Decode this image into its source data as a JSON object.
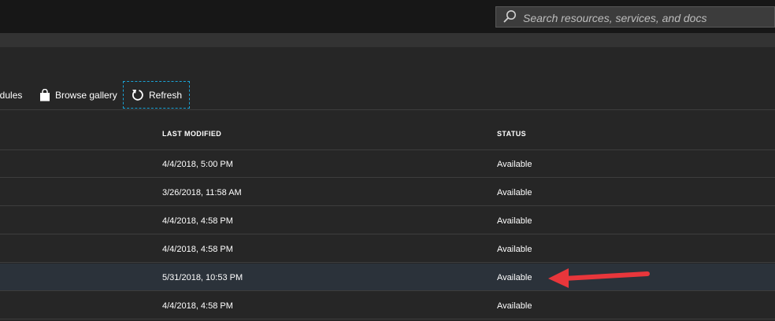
{
  "search": {
    "placeholder": "Search resources, services, and docs",
    "icon": "search-icon"
  },
  "toolbar": {
    "partial_label": "odules",
    "browse_label": "Browse gallery",
    "browse_icon": "shopping-bag-icon",
    "refresh_label": "Refresh",
    "refresh_icon": "refresh-icon"
  },
  "table": {
    "columns": [
      "LAST MODIFIED",
      "STATUS"
    ],
    "rows": [
      {
        "last_modified": "4/4/2018, 5:00 PM",
        "status": "Available"
      },
      {
        "last_modified": "3/26/2018, 11:58 AM",
        "status": "Available"
      },
      {
        "last_modified": "4/4/2018, 4:58 PM",
        "status": "Available"
      },
      {
        "last_modified": "4/4/2018, 4:58 PM",
        "status": "Available"
      },
      {
        "last_modified": "5/31/2018, 10:53 PM",
        "status": "Available"
      },
      {
        "last_modified": "4/4/2018, 4:58 PM",
        "status": "Available"
      }
    ],
    "highlighted_row": 4
  },
  "colors": {
    "background": "#262626",
    "topbar": "#171717",
    "highlight_row": "#2b323a",
    "focus_border": "#1aa3d6",
    "annotation_arrow": "#e8363b"
  }
}
